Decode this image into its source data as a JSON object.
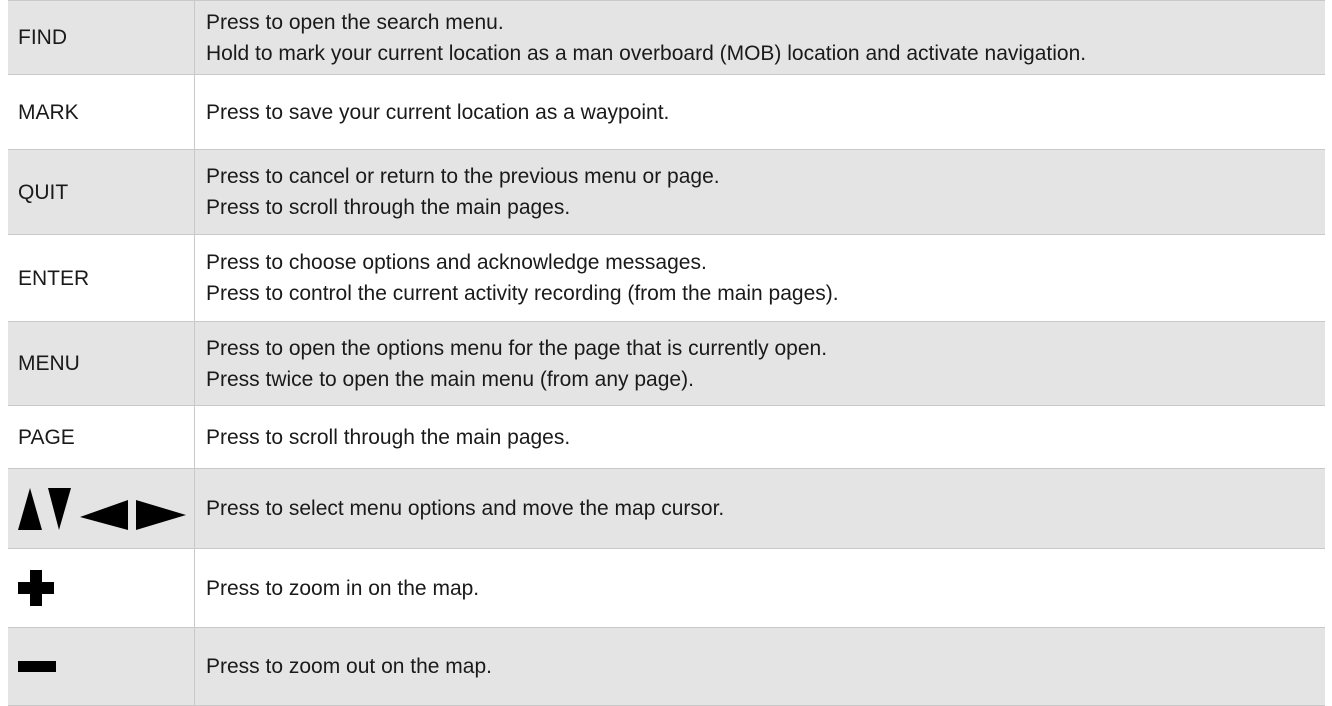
{
  "rows": [
    {
      "key": "FIND",
      "lines": [
        "Press to open the search menu.",
        "Hold to mark your current location as a man overboard (MOB) location and activate navigation."
      ]
    },
    {
      "key": "MARK",
      "lines": [
        "Press to save your current location as a waypoint."
      ]
    },
    {
      "key": "QUIT",
      "lines": [
        "Press to cancel or return to the previous menu or page.",
        "Press to scroll through the main pages."
      ]
    },
    {
      "key": "ENTER",
      "lines": [
        "Press to choose options and acknowledge messages.",
        "Press to control the current activity recording (from the main pages)."
      ]
    },
    {
      "key": "MENU",
      "lines": [
        "Press to open the options menu for the page that is currently open.",
        "Press twice to open the main menu (from any page)."
      ]
    },
    {
      "key": "PAGE",
      "lines": [
        "Press to scroll through the main pages."
      ]
    },
    {
      "key_icons": [
        "up-arrow-icon",
        "down-arrow-icon",
        "left-arrow-icon",
        "right-arrow-icon"
      ],
      "lines": [
        "Press to select menu options and move the map cursor."
      ]
    },
    {
      "key_icons": [
        "plus-icon"
      ],
      "lines": [
        "Press to zoom in on the map."
      ]
    },
    {
      "key_icons": [
        "minus-icon"
      ],
      "lines": [
        "Press to zoom out on the map."
      ]
    }
  ],
  "colors": {
    "shaded_row": "#e4e4e4",
    "border": "#c9c9c9",
    "text": "#1a1a1a",
    "icon": "#000000"
  }
}
